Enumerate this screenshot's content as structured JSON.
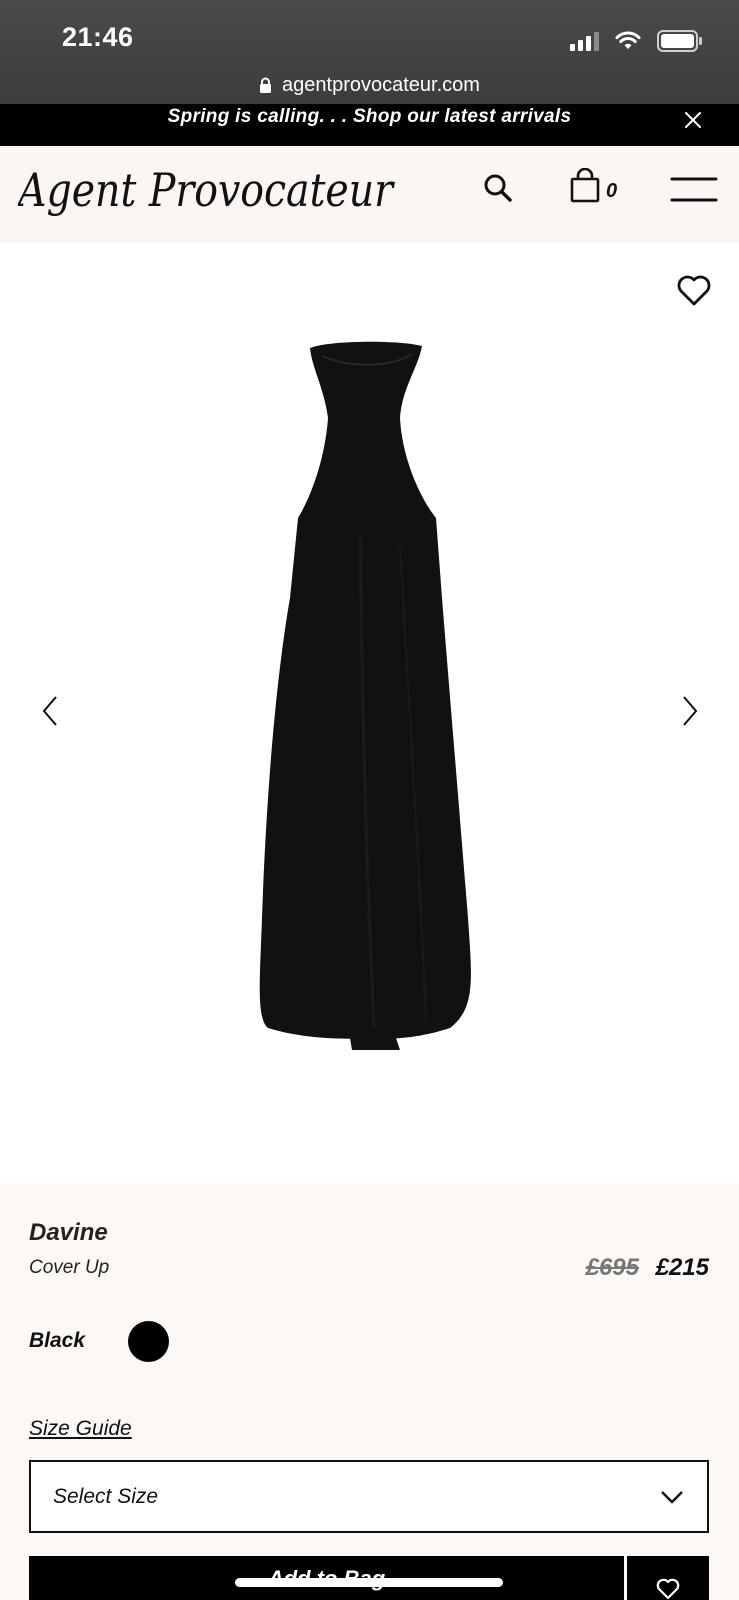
{
  "status_bar": {
    "time": "21:46"
  },
  "browser": {
    "url": "agentprovocateur.com"
  },
  "promo_banner": {
    "text": "Spring is calling. . . Shop our latest arrivals"
  },
  "header": {
    "logo_text": "Agent Provocateur",
    "bag_count": "0",
    "icons": [
      "search-icon",
      "shopping-bag-icon",
      "hamburger-menu-icon"
    ]
  },
  "gallery": {
    "icons": [
      "heart-icon",
      "chevron-left-icon",
      "chevron-right-icon"
    ]
  },
  "product": {
    "name": "Davine",
    "subtitle": "Cover Up",
    "price_original": "£695",
    "price_sale": "£215",
    "colour": "Black",
    "colour_hex": "#000000",
    "size_guide_label": "Size Guide",
    "size_select_placeholder": "Select Size",
    "add_to_bag_label": "Add to Bag"
  }
}
